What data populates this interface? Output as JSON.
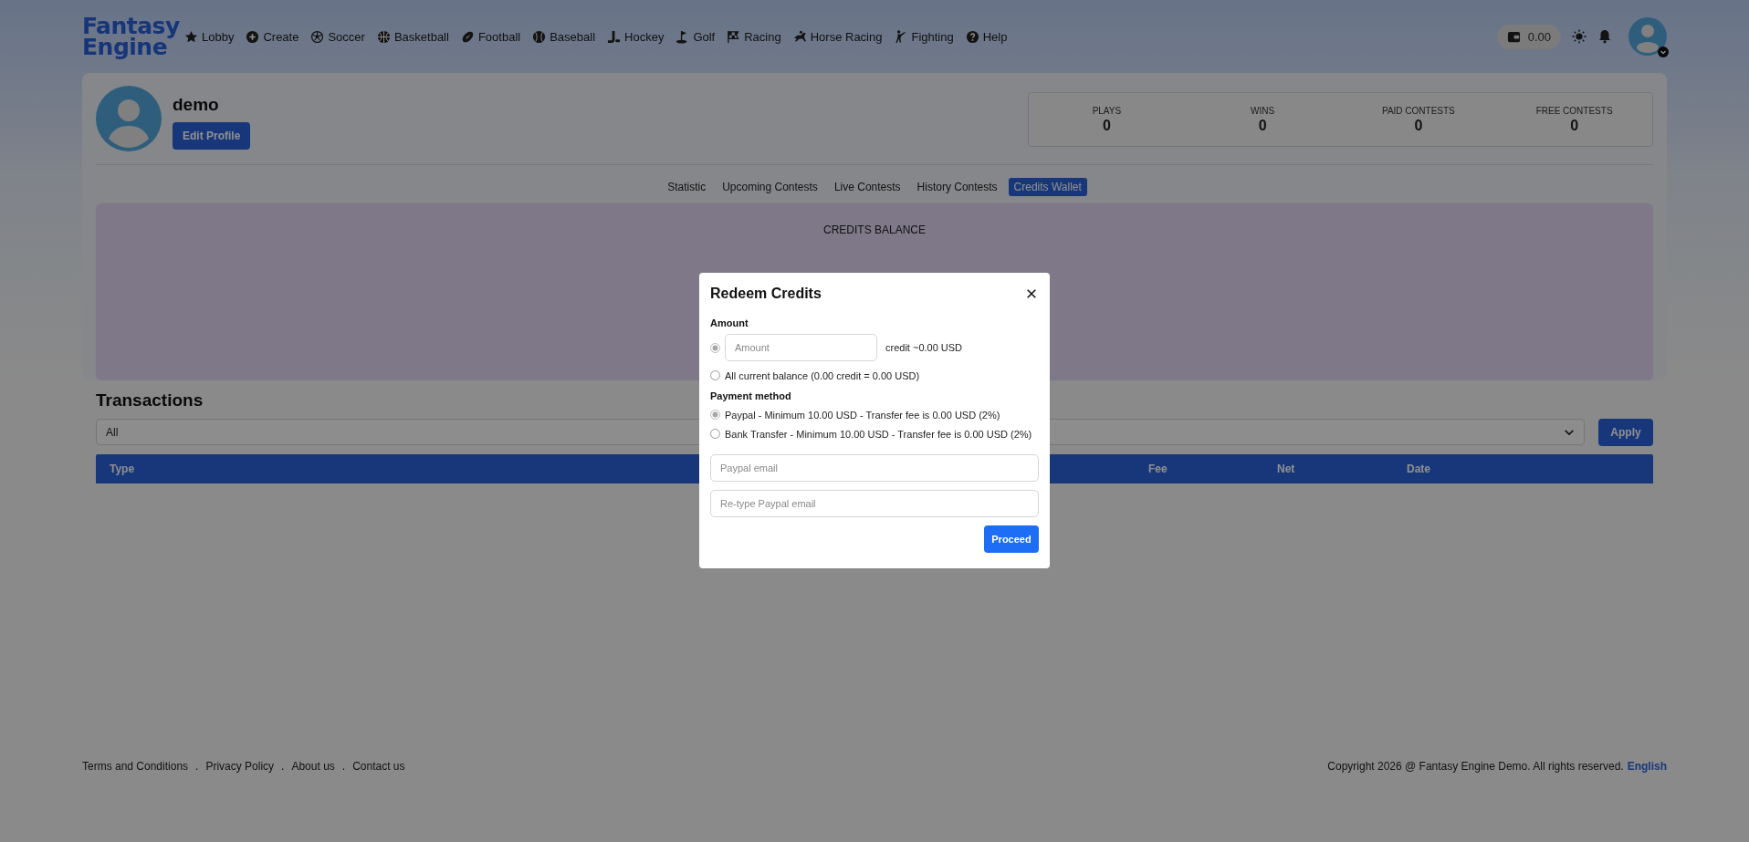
{
  "header": {
    "logo": "Fantasy Engine",
    "nav": [
      {
        "label": "Lobby"
      },
      {
        "label": "Create"
      },
      {
        "label": "Soccer"
      },
      {
        "label": "Basketball"
      },
      {
        "label": "Football"
      },
      {
        "label": "Baseball"
      },
      {
        "label": "Hockey"
      },
      {
        "label": "Golf"
      },
      {
        "label": "Racing"
      },
      {
        "label": "Horse Racing"
      },
      {
        "label": "Fighting"
      },
      {
        "label": "Help"
      }
    ],
    "wallet_balance": "0.00"
  },
  "profile": {
    "username": "demo",
    "edit_button": "Edit Profile",
    "stats": [
      {
        "label": "PLAYS",
        "value": "0"
      },
      {
        "label": "WINS",
        "value": "0"
      },
      {
        "label": "PAID CONTESTS",
        "value": "0"
      },
      {
        "label": "FREE CONTESTS",
        "value": "0"
      }
    ]
  },
  "tabs": [
    {
      "label": "Statistic",
      "selected": false
    },
    {
      "label": "Upcoming Contests",
      "selected": false
    },
    {
      "label": "Live Contests",
      "selected": false
    },
    {
      "label": "History Contests",
      "selected": false
    },
    {
      "label": "Credits Wallet",
      "selected": true
    }
  ],
  "balance": {
    "title": "CREDITS BALANCE"
  },
  "transactions": {
    "title": "Transactions",
    "filter": "All",
    "apply_button": "Apply",
    "columns": [
      "Type",
      "Fee",
      "Net",
      "Date"
    ]
  },
  "modal": {
    "title": "Redeem Credits",
    "amount_label": "Amount",
    "amount_options": [
      {
        "kind": "input",
        "placeholder": "Amount",
        "suffix": "credit ~0.00 USD",
        "selected": true
      },
      {
        "kind": "label",
        "label": "All current balance (0.00 credit = 0.00 USD)",
        "selected": false
      }
    ],
    "payment_label": "Payment method",
    "payment_methods": [
      {
        "label": "Paypal - Minimum 10.00 USD - Transfer fee is 0.00 USD (2%)",
        "selected": true
      },
      {
        "label": "Bank Transfer - Minimum 10.00 USD - Transfer fee is 0.00 USD (2%)",
        "selected": false
      }
    ],
    "fields": [
      {
        "placeholder": "Paypal email"
      },
      {
        "placeholder": "Re-type Paypal email"
      }
    ],
    "proceed_button": "Proceed"
  },
  "footer": {
    "links": [
      "Terms and Conditions",
      "Privacy Policy",
      "About us",
      "Contact us"
    ],
    "separator": ".",
    "copyright": "Copyright 2026 @ Fantasy Engine Demo. All rights reserved.",
    "language": "English"
  }
}
